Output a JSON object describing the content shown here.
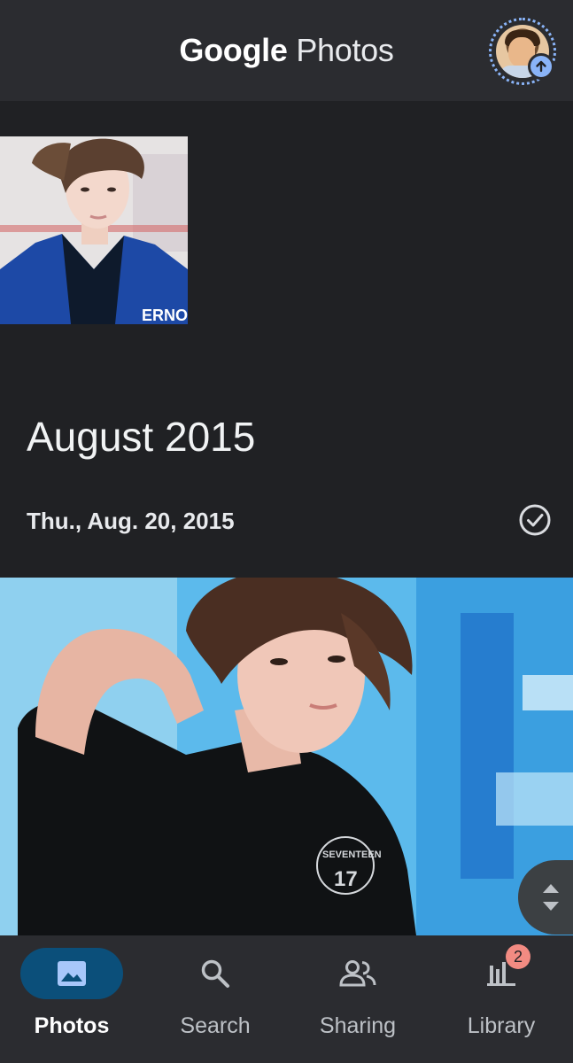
{
  "header": {
    "brand": "Google",
    "product": "Photos",
    "avatar_icon": "avatar",
    "upload_icon": "arrow-up-icon"
  },
  "timeline": {
    "month_heading": "August 2015",
    "date_heading": "Thu., Aug. 20, 2015",
    "select_icon": "check-circle-icon",
    "thumb_caption": "ERNON",
    "shirt_logo_text": "SEVENTEEN",
    "shirt_logo_mark": "17"
  },
  "bottom_nav": {
    "items": [
      {
        "label": "Photos",
        "icon": "photo-icon",
        "active": true
      },
      {
        "label": "Search",
        "icon": "search-icon",
        "active": false
      },
      {
        "label": "Sharing",
        "icon": "people-icon",
        "active": false
      },
      {
        "label": "Library",
        "icon": "library-icon",
        "active": false,
        "badge": "2"
      }
    ]
  },
  "colors": {
    "background": "#202124",
    "header": "#2b2c30",
    "active_pill": "#0b4f7a",
    "badge": "#f28b82",
    "avatar_ring": "#8ab4f8"
  }
}
